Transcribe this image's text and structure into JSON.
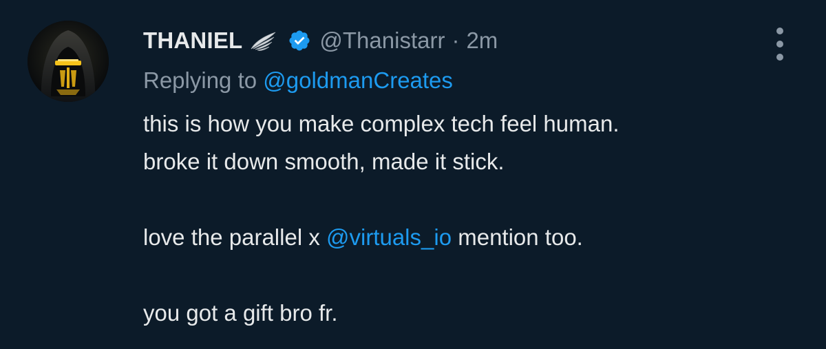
{
  "tweet": {
    "author": {
      "display_name": "THANIEL",
      "badge_icon": "wing-icon",
      "verified_icon": "verified-badge-icon",
      "handle": "@Thanistarr",
      "separator": "·",
      "time": "2m"
    },
    "replying": {
      "prefix": "Replying to",
      "mention": "@goldmanCreates"
    },
    "body": {
      "line1": "this is how you make complex tech feel human.",
      "line2": "broke it down smooth, made it stick.",
      "line3_before": "love the parallel x ",
      "line3_mention": "@virtuals_io",
      "line3_after": " mention too.",
      "line4": "you got a gift bro fr."
    },
    "menu_icon": "more-vertical-icon"
  },
  "colors": {
    "background": "#0c1b29",
    "text_primary": "#e7e9ea",
    "text_secondary": "#8b98a5",
    "link": "#1d9bf0",
    "verified": "#1d9bf0"
  }
}
